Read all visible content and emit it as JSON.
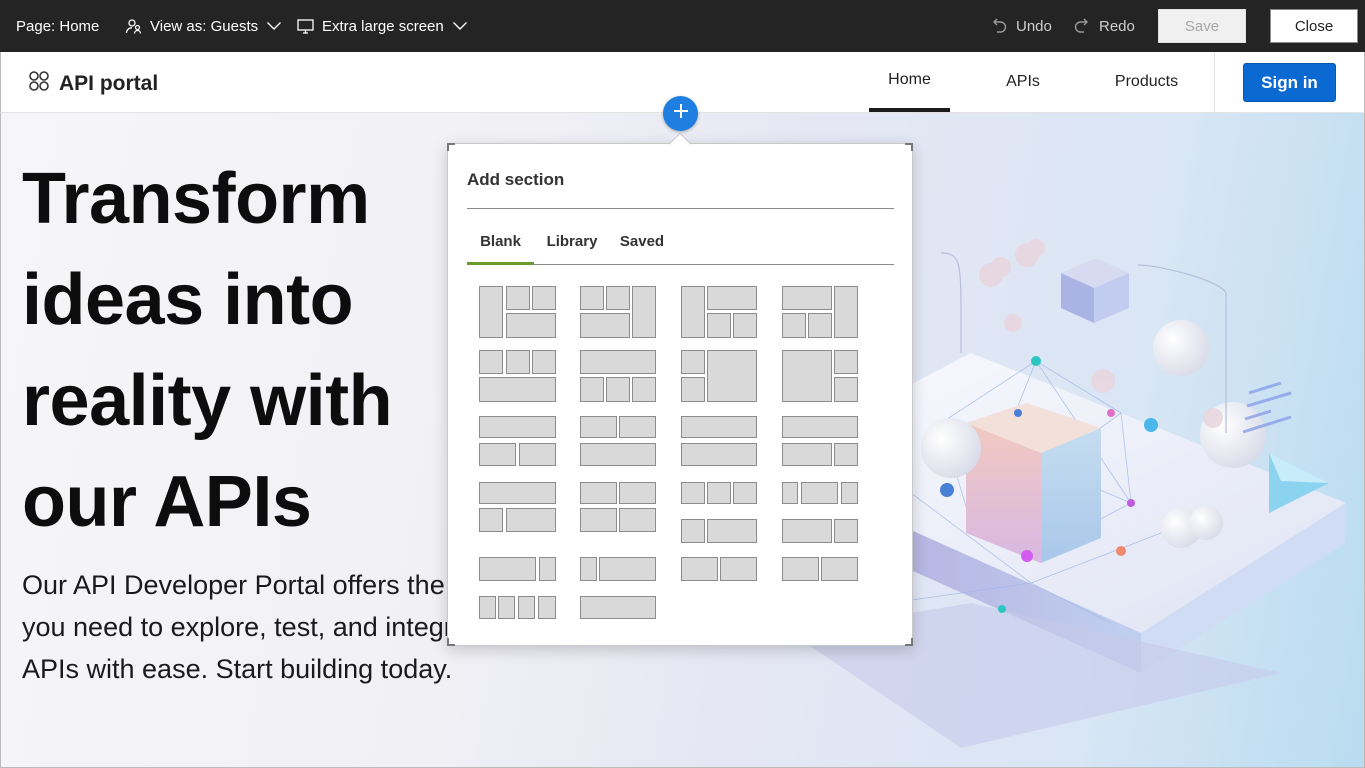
{
  "editor_bar": {
    "page_label": "Page: Home",
    "view_as_label": "View as: Guests",
    "screen_label": "Extra large screen",
    "undo_label": "Undo",
    "redo_label": "Redo",
    "save_label": "Save",
    "close_label": "Close"
  },
  "site": {
    "brand": "API portal",
    "nav": [
      "Home",
      "APIs",
      "Products"
    ],
    "sign_in": "Sign in"
  },
  "hero": {
    "title": "Transform ideas into reality with our APIs",
    "subtitle": "Our API Developer Portal offers the tools you need to explore, test, and integrate APIs with ease. Start building today."
  },
  "add_section": {
    "title": "Add section",
    "tabs": [
      "Blank",
      "Library",
      "Saved"
    ],
    "active_tab": "Blank"
  },
  "colors": {
    "editor_bar": "#242424",
    "primary": "#0b6ad1",
    "add_button": "#1f7fe0",
    "tab_underline": "#6a9a2c"
  }
}
